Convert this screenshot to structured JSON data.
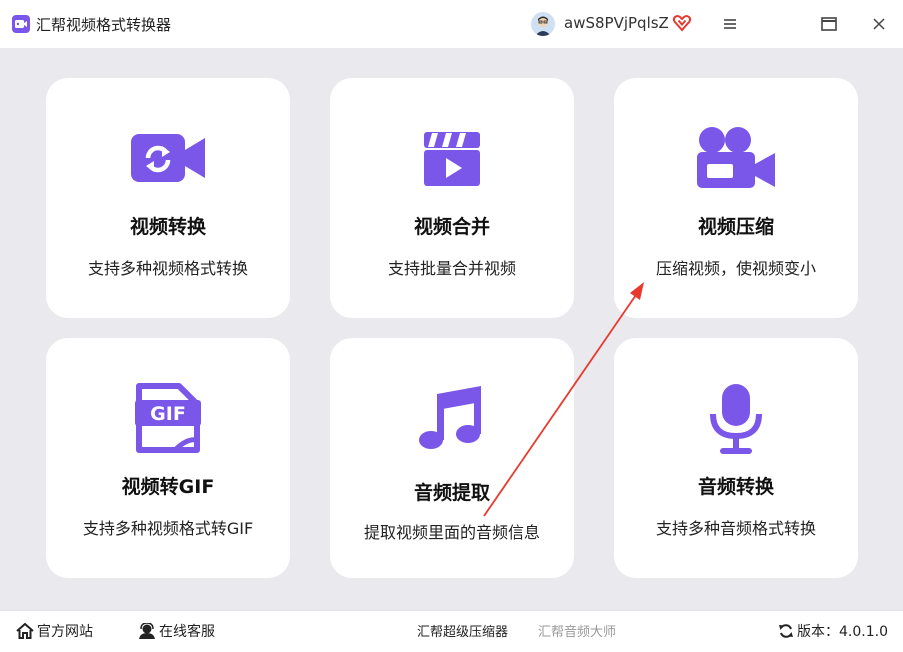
{
  "app": {
    "title": "汇帮视频格式转换器"
  },
  "header": {
    "username": "awS8PVjPqlsZ",
    "icons": [
      "user-avatar",
      "vip-heart-icon",
      "menu-icon",
      "maximize-icon",
      "close-icon"
    ]
  },
  "cards": [
    {
      "title": "视频转换",
      "desc": "支持多种视频格式转换",
      "icon": "video-convert-icon"
    },
    {
      "title": "视频合并",
      "desc": "支持批量合并视频",
      "icon": "video-merge-icon"
    },
    {
      "title": "视频压缩",
      "desc": "压缩视频，使视频变小",
      "icon": "video-camera-icon"
    },
    {
      "title": "视频转GIF",
      "desc": "支持多种视频格式转GIF",
      "icon": "gif-file-icon"
    },
    {
      "title": "音频提取",
      "desc": "提取视频里面的音频信息",
      "icon": "music-note-icon"
    },
    {
      "title": "音频转换",
      "desc": "支持多种音频格式转换",
      "icon": "microphone-icon"
    }
  ],
  "footer": {
    "website": "官方网站",
    "support": "在线客服",
    "link1": "汇帮超级压缩器",
    "link2": "汇帮音频大师",
    "version": "版本：4.0.1.0"
  },
  "colors": {
    "accent": "#7a57e8",
    "background": "#e9e9ee",
    "card": "#ffffff",
    "annotation_arrow": "#e8392e"
  }
}
